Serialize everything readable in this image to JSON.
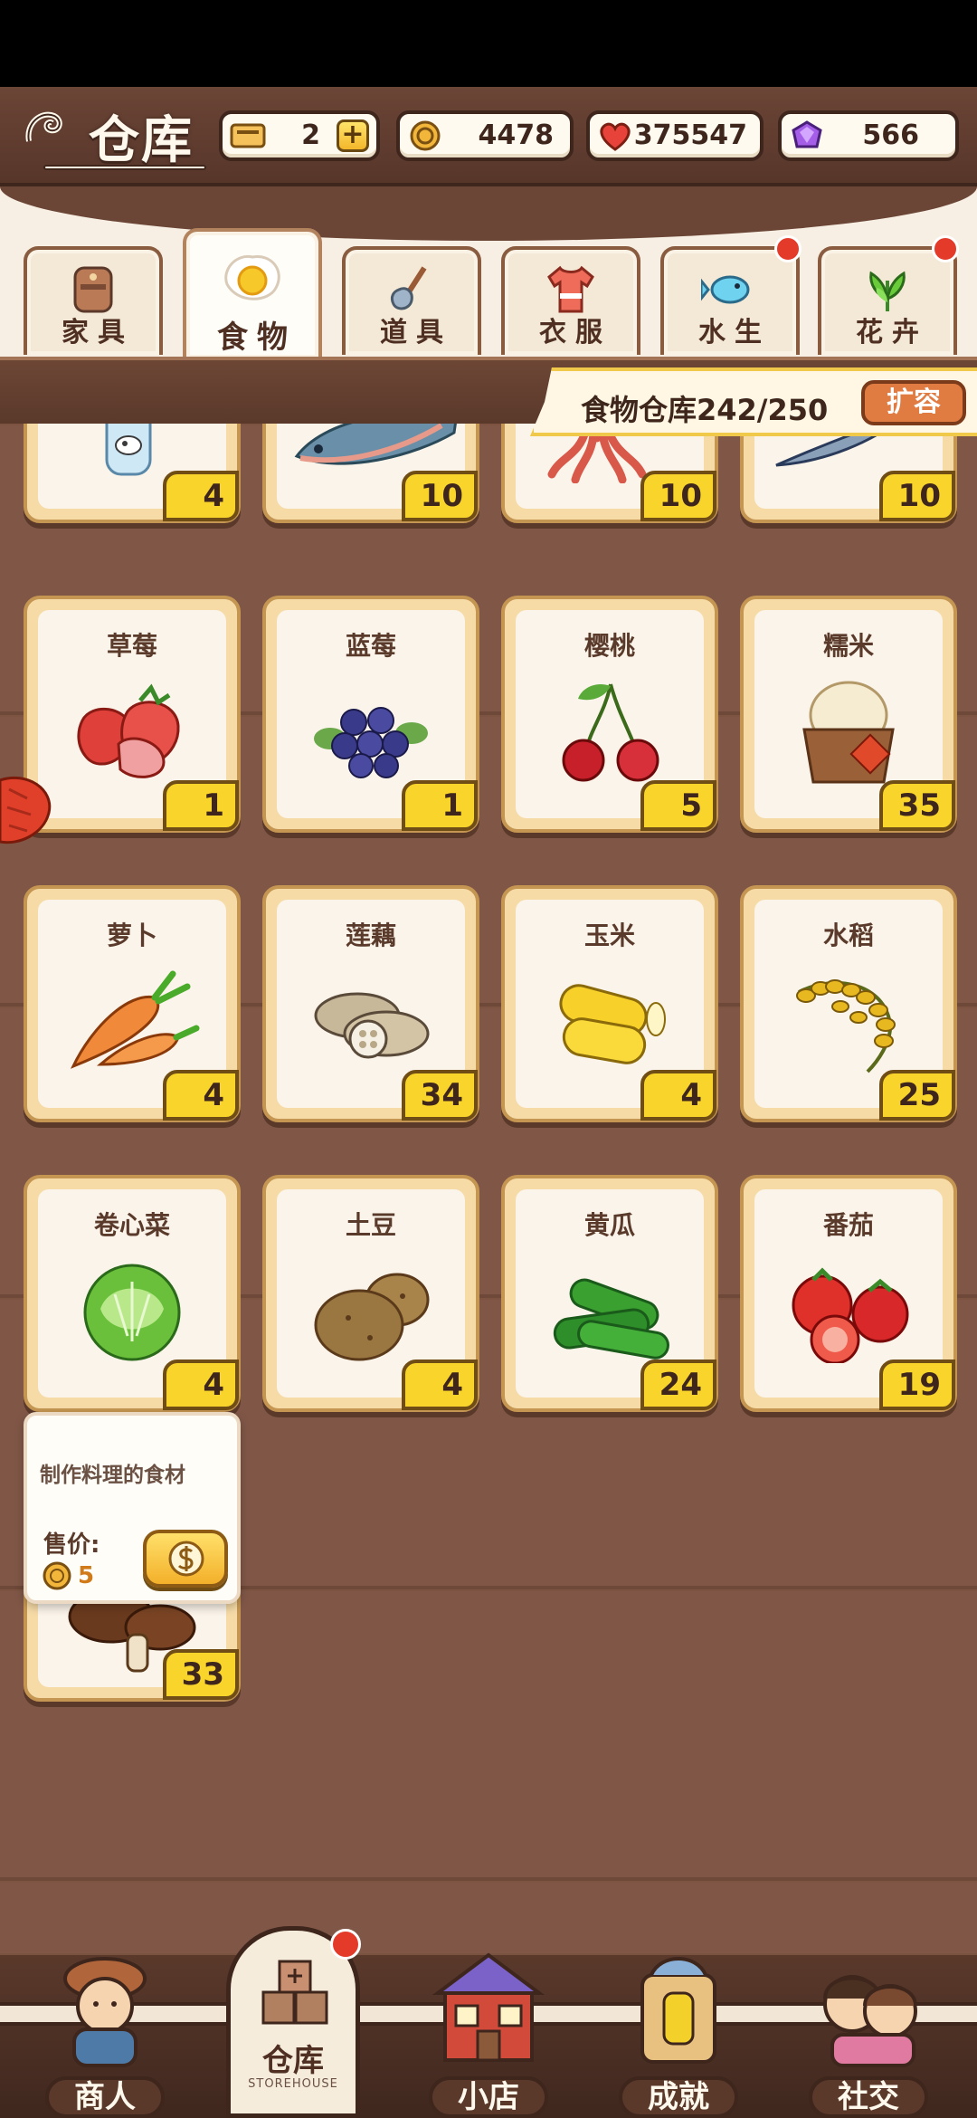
{
  "header": {
    "title": "仓库",
    "resources": [
      {
        "name": "ticket",
        "value": "2",
        "icon": "ticket-icon"
      },
      {
        "name": "coins",
        "value": "4478",
        "icon": "coin-icon"
      },
      {
        "name": "hearts",
        "value": "375547",
        "icon": "heart-icon"
      },
      {
        "name": "gems",
        "value": "566",
        "icon": "gem-icon"
      }
    ],
    "plus_label": "+"
  },
  "tabs": [
    {
      "label": "家具",
      "icon": "furniture-icon",
      "active": false,
      "badge": false
    },
    {
      "label": "食物",
      "icon": "egg-icon",
      "active": true,
      "badge": false
    },
    {
      "label": "道具",
      "icon": "shovel-icon",
      "active": false,
      "badge": false
    },
    {
      "label": "衣服",
      "icon": "shirt-icon",
      "active": false,
      "badge": false
    },
    {
      "label": "水生",
      "icon": "fish-icon",
      "active": false,
      "badge": true
    },
    {
      "label": "花卉",
      "icon": "plant-icon",
      "active": false,
      "badge": true
    }
  ],
  "capacity": {
    "text": "食物仓库242/250",
    "expand_label": "扩容"
  },
  "items_top_partial": [
    {
      "count": "4",
      "icon": "milk-icon"
    },
    {
      "count": "10",
      "icon": "salmon-icon"
    },
    {
      "count": "10",
      "icon": "squid-icon"
    },
    {
      "count": "10",
      "icon": "saury-icon"
    }
  ],
  "items": [
    {
      "name": "草莓",
      "count": "1",
      "icon": "strawberry-icon"
    },
    {
      "name": "蓝莓",
      "count": "1",
      "icon": "blueberry-icon"
    },
    {
      "name": "樱桃",
      "count": "5",
      "icon": "cherry-icon"
    },
    {
      "name": "糯米",
      "count": "35",
      "icon": "rice-basket-icon"
    },
    {
      "name": "萝卜",
      "count": "4",
      "icon": "carrot-icon"
    },
    {
      "name": "莲藕",
      "count": "34",
      "icon": "lotus-root-icon"
    },
    {
      "name": "玉米",
      "count": "4",
      "icon": "corn-icon"
    },
    {
      "name": "水稻",
      "count": "25",
      "icon": "rice-plant-icon"
    },
    {
      "name": "卷心菜",
      "count": "4",
      "icon": "cabbage-icon"
    },
    {
      "name": "土豆",
      "count": "4",
      "icon": "potato-icon"
    },
    {
      "name": "黄瓜",
      "count": "24",
      "icon": "cucumber-icon"
    },
    {
      "name": "番茄",
      "count": "19",
      "icon": "tomato-icon"
    }
  ],
  "selected_item": {
    "name": "香菇",
    "count": "33",
    "icon": "mushroom-icon"
  },
  "tooltip": {
    "description": "制作料理的食材",
    "price_label": "售价:",
    "price": "5",
    "sell_icon": "dollar-icon"
  },
  "bottom_nav": [
    {
      "label": "商人",
      "icon": "merchant-icon"
    },
    {
      "label": "仓库",
      "sub": "STOREHOUSE",
      "icon": "storehouse-icon",
      "active": true,
      "badge": true
    },
    {
      "label": "小店",
      "icon": "shop-icon"
    },
    {
      "label": "成就",
      "icon": "achievement-icon"
    },
    {
      "label": "社交",
      "icon": "social-icon"
    }
  ]
}
